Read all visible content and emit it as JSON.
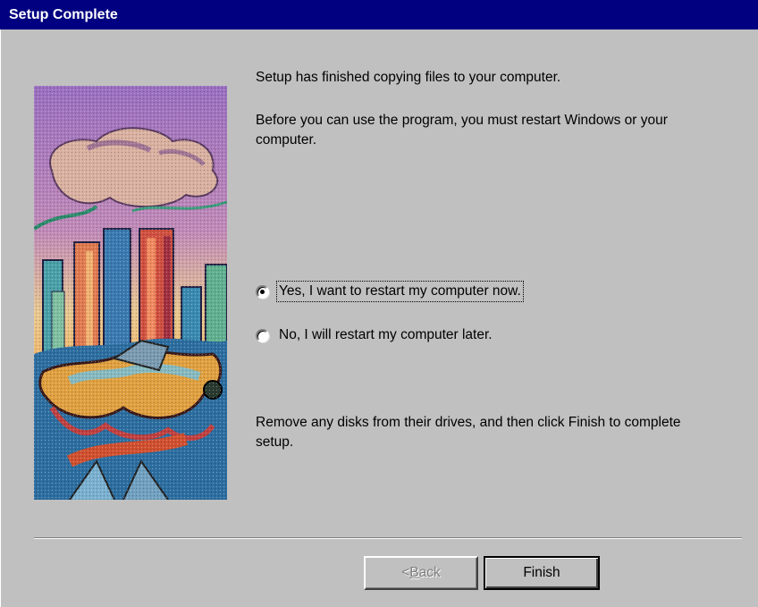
{
  "window": {
    "title": "Setup Complete"
  },
  "content": {
    "message_finished": "Setup has finished copying files to your computer.",
    "message_restart": "Before you can use the program, you must restart Windows or your computer.",
    "message_remove_disks": "Remove any disks from their drives, and then click Finish to complete setup."
  },
  "options": {
    "restart_now_label": "Yes, I want to restart my computer now.",
    "restart_later_label": "No, I will restart my computer later.",
    "selected": "restart_now"
  },
  "buttons": {
    "back_label": "< Back",
    "back_enabled": false,
    "finish_label": "Finish"
  },
  "colors": {
    "title_bar": "#000080",
    "dialog_face": "#c0c0c0",
    "disabled_text": "#808080"
  },
  "illustration": {
    "icon": "city-skyline-artwork"
  }
}
